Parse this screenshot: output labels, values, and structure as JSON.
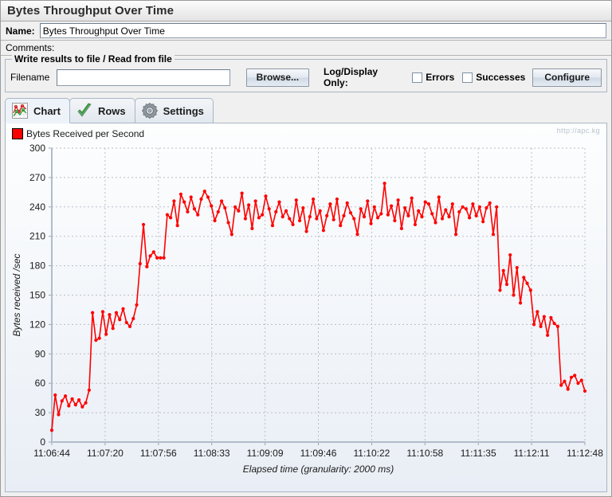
{
  "window": {
    "title": "Bytes Throughput Over Time"
  },
  "form": {
    "name_label": "Name:",
    "name_value": "Bytes Throughput Over Time",
    "comments_label": "Comments:",
    "comments_value": "",
    "file_panel_title": "Write results to file / Read from file",
    "filename_label": "Filename",
    "filename_value": "",
    "browse_label": "Browse...",
    "log_display_label": "Log/Display Only:",
    "errors_label": "Errors",
    "errors_checked": false,
    "successes_label": "Successes",
    "successes_checked": false,
    "configure_label": "Configure"
  },
  "tabs": [
    {
      "label": "Chart",
      "icon": "chart-icon",
      "active": true
    },
    {
      "label": "Rows",
      "icon": "checkmark-icon",
      "active": false
    },
    {
      "label": "Settings",
      "icon": "gear-icon",
      "active": false
    }
  ],
  "chart_meta": {
    "watermark": "http://apc.kg"
  },
  "chart_data": {
    "type": "line",
    "title": "",
    "subtitle": "",
    "xlabel": "Elapsed time (granularity: 2000 ms)",
    "ylabel": "Bytes received /sec",
    "legend": [
      "Bytes Received per Second"
    ],
    "legend_position": "top-left",
    "series_color": "#ff0000",
    "grid": true,
    "ylim": [
      0,
      300
    ],
    "yticks": [
      0,
      30,
      60,
      90,
      120,
      150,
      180,
      210,
      240,
      270,
      300
    ],
    "xticks": [
      "11:06:44",
      "11:07:20",
      "11:07:56",
      "11:08:33",
      "11:09:09",
      "11:09:46",
      "11:10:22",
      "11:10:58",
      "11:11:35",
      "11:12:11",
      "11:12:48"
    ],
    "x_start": "11:06:44",
    "x_end": "11:12:48",
    "granularity_ms": 2000,
    "series": [
      {
        "name": "Bytes Received per Second",
        "values": [
          12,
          48,
          28,
          42,
          47,
          37,
          44,
          38,
          43,
          36,
          40,
          53,
          132,
          104,
          106,
          133,
          110,
          130,
          116,
          132,
          125,
          136,
          122,
          118,
          126,
          140,
          182,
          222,
          179,
          190,
          194,
          188,
          188,
          188,
          232,
          229,
          246,
          221,
          253,
          245,
          235,
          250,
          238,
          232,
          248,
          256,
          250,
          241,
          226,
          235,
          246,
          239,
          224,
          212,
          240,
          236,
          254,
          228,
          242,
          218,
          246,
          229,
          232,
          251,
          238,
          221,
          235,
          245,
          230,
          236,
          228,
          222,
          247,
          226,
          239,
          215,
          230,
          248,
          228,
          236,
          216,
          231,
          243,
          227,
          248,
          221,
          231,
          244,
          234,
          228,
          212,
          238,
          230,
          246,
          223,
          240,
          229,
          233,
          264,
          232,
          241,
          226,
          247,
          218,
          239,
          231,
          249,
          222,
          236,
          230,
          245,
          243,
          233,
          224,
          250,
          228,
          237,
          230,
          243,
          212,
          235,
          240,
          238,
          229,
          243,
          231,
          240,
          225,
          239,
          244,
          212,
          240,
          155,
          175,
          161,
          191,
          150,
          178,
          142,
          168,
          162,
          155,
          120,
          133,
          118,
          128,
          109,
          127,
          121,
          118,
          58,
          62,
          54,
          66,
          68,
          60,
          63,
          52
        ]
      }
    ]
  }
}
